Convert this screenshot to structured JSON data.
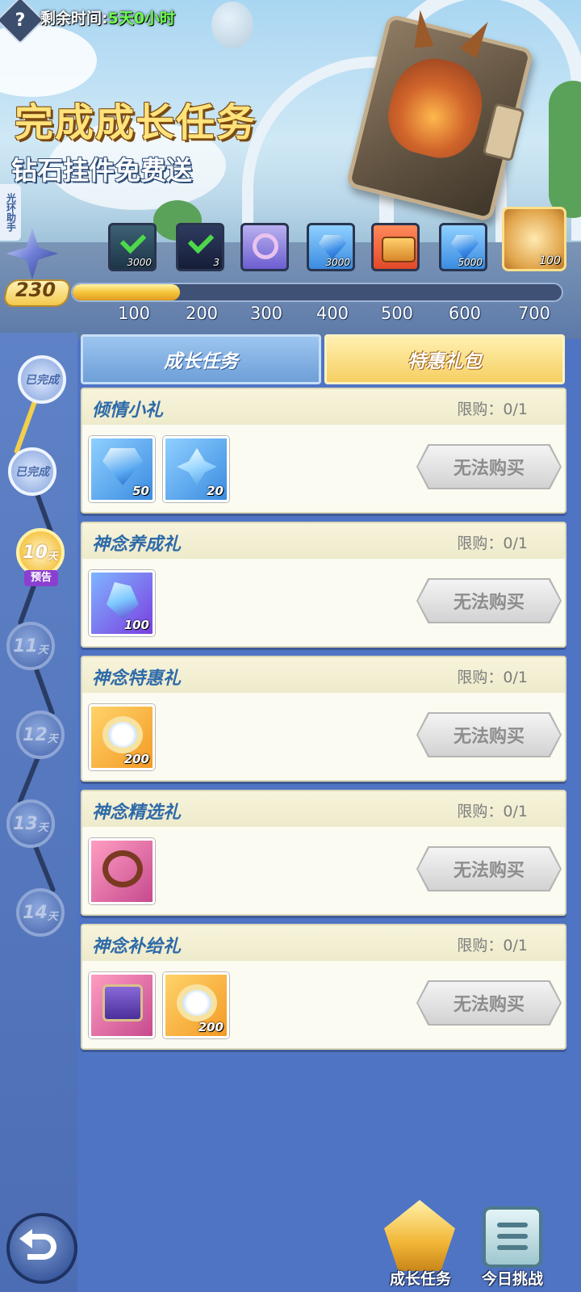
{
  "header": {
    "help_icon": "?",
    "timer_label": "剩余时间:",
    "timer_value": "5天0小时",
    "title": "完成成长任务",
    "subtitle": "钻石挂件免费送",
    "side_tab": "光环助手"
  },
  "progress": {
    "points": "230",
    "fraction": 0.22,
    "ticks": [
      "100",
      "200",
      "300",
      "400",
      "500",
      "600",
      "700"
    ],
    "rewards": [
      {
        "icon": "gem-claimed",
        "qty": "3000",
        "claimed": true
      },
      {
        "icon": "gem-claimed",
        "qty": "3",
        "claimed": true
      },
      {
        "icon": "ring-icon",
        "qty": "",
        "claimed": false
      },
      {
        "icon": "diamond-icon",
        "qty": "3000",
        "claimed": false
      },
      {
        "icon": "chest-icon",
        "qty": "",
        "claimed": false
      },
      {
        "icon": "diamond-icon",
        "qty": "5000",
        "claimed": false
      }
    ],
    "final_reward_qty": "100"
  },
  "days": [
    {
      "label": "已完成",
      "state": "done"
    },
    {
      "label": "已完成",
      "state": "done"
    },
    {
      "label": "10",
      "unit": "天",
      "state": "current",
      "tag": "预告"
    },
    {
      "label": "11",
      "unit": "天",
      "state": "locked"
    },
    {
      "label": "12",
      "unit": "天",
      "state": "locked"
    },
    {
      "label": "13",
      "unit": "天",
      "state": "locked"
    },
    {
      "label": "14",
      "unit": "天",
      "state": "locked"
    }
  ],
  "tabs": {
    "growth": "成长任务",
    "special": "特惠礼包"
  },
  "packs": [
    {
      "title": "倾情小礼",
      "limit": "限购：0/1",
      "button": "无法购买",
      "items": [
        {
          "icon": "diamond-icon",
          "qty": "50",
          "bg": "blue"
        },
        {
          "icon": "crystal-shard-icon",
          "qty": "20",
          "bg": "blue"
        }
      ]
    },
    {
      "title": "神念养成礼",
      "limit": "限购：0/1",
      "button": "无法购买",
      "items": [
        {
          "icon": "crystal-book-icon",
          "qty": "100",
          "bg": "purple"
        }
      ]
    },
    {
      "title": "神念特惠礼",
      "limit": "限购：0/1",
      "button": "无法购买",
      "items": [
        {
          "icon": "halo-ring-icon",
          "qty": "200",
          "bg": "orange"
        }
      ]
    },
    {
      "title": "神念精选礼",
      "limit": "限购：0/1",
      "button": "无法购买",
      "items": [
        {
          "icon": "thorn-crown-icon",
          "qty": "",
          "bg": "pink"
        }
      ]
    },
    {
      "title": "神念补给礼",
      "limit": "限购：0/1",
      "button": "无法购买",
      "items": [
        {
          "icon": "altar-chest-icon",
          "qty": "",
          "bg": "pink"
        },
        {
          "icon": "halo-ring-icon",
          "qty": "200",
          "bg": "orange"
        }
      ]
    }
  ],
  "bottom_nav": {
    "growth": "成长任务",
    "daily": "今日挑战"
  }
}
